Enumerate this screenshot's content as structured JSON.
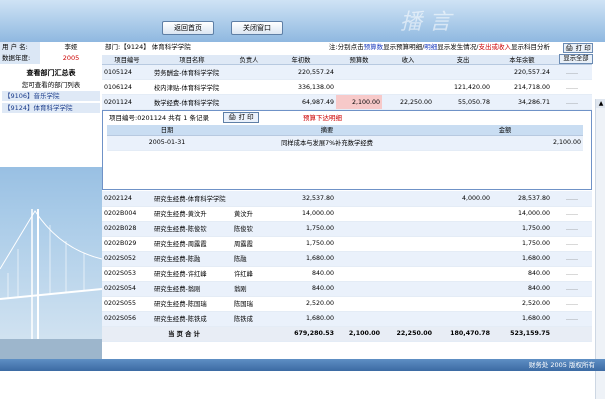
{
  "top": {
    "deco": "播 言",
    "btn_home": "返回首页",
    "btn_close": "关闭窗口"
  },
  "side": {
    "user_k": "用 户 名:",
    "user_v": "李娅",
    "year_k": "数据年度:",
    "year_v": "2005",
    "title": "查看部门汇总表",
    "sub": "您可查看的部门列表",
    "items": [
      "【9106】音乐学院",
      "【9124】体育科学学院"
    ]
  },
  "header": {
    "dept": "部门:【9124】 体育科学学院",
    "n1": "注:分别点击",
    "n2": "预算数",
    "n3": "显示预算明细/",
    "n4": "明细",
    "n5": "显示发生情况/",
    "n6": "支出或收入",
    "n7": "显示科目分析",
    "print": "打 印",
    "show_all": "显示全部"
  },
  "cols": [
    "项目编号",
    "项目名称",
    "负责人",
    "年初数",
    "预算数",
    "收入",
    "支出",
    "本年余额",
    "明细"
  ],
  "rows_top": [
    [
      "0105124",
      "劳务酬金-体育科学学院",
      "",
      "220,557.24",
      "",
      "",
      "",
      "220,557.24",
      "......"
    ],
    [
      "0106124",
      "校内津贴-体育科学学院",
      "",
      "336,138.00",
      "",
      "",
      "121,420.00",
      "214,718.00",
      "......"
    ],
    [
      "0201124",
      "数学经费-体育科学学院",
      "",
      "64,987.49",
      "2,100.00",
      "22,250.00",
      "55,050.78",
      "34,286.71",
      "......"
    ]
  ],
  "detail": {
    "head": "项目编号:0201124  共有 1 条记录",
    "print": "打 印",
    "red": "预算下达明细",
    "cols": [
      "日期",
      "摘要",
      "金额"
    ],
    "row": [
      "2005-01-31",
      "同样成本与发展7%补充数学经费",
      "2,100.00"
    ]
  },
  "rows_bot": [
    [
      "0202124",
      "研究生经费-体育科学学院",
      "",
      "32,537.80",
      "",
      "",
      "4,000.00",
      "28,537.80",
      "......"
    ],
    [
      "0202B004",
      "研究生经费-黄汶升",
      "黄汶升",
      "14,000.00",
      "",
      "",
      "",
      "14,000.00",
      "......"
    ],
    [
      "0202B028",
      "研究生经费-陈俊钦",
      "陈俊钦",
      "1,750.00",
      "",
      "",
      "",
      "1,750.00",
      "......"
    ],
    [
      "0202B029",
      "研究生经费-周露霞",
      "周露霞",
      "1,750.00",
      "",
      "",
      "",
      "1,750.00",
      "......"
    ],
    [
      "0202S052",
      "研究生经费-陈融",
      "陈融",
      "1,680.00",
      "",
      "",
      "",
      "1,680.00",
      "......"
    ],
    [
      "0202S053",
      "研究生经费-许红峰",
      "许红峰",
      "840.00",
      "",
      "",
      "",
      "840.00",
      "......"
    ],
    [
      "0202S054",
      "研究生经费-翁刚",
      "翁刚",
      "840.00",
      "",
      "",
      "",
      "840.00",
      "......"
    ],
    [
      "0202S055",
      "研究生经费-陈国瑞",
      "陈国瑞",
      "2,520.00",
      "",
      "",
      "",
      "2,520.00",
      "......"
    ],
    [
      "0202S056",
      "研究生经费-陈铁成",
      "陈铁成",
      "1,680.00",
      "",
      "",
      "",
      "1,680.00",
      "......"
    ]
  ],
  "total": [
    "当 页 合 计",
    "679,280.53",
    "2,100.00",
    "22,250.00",
    "180,470.78",
    "523,159.75"
  ],
  "footer": "财务处 2005 版权所有"
}
